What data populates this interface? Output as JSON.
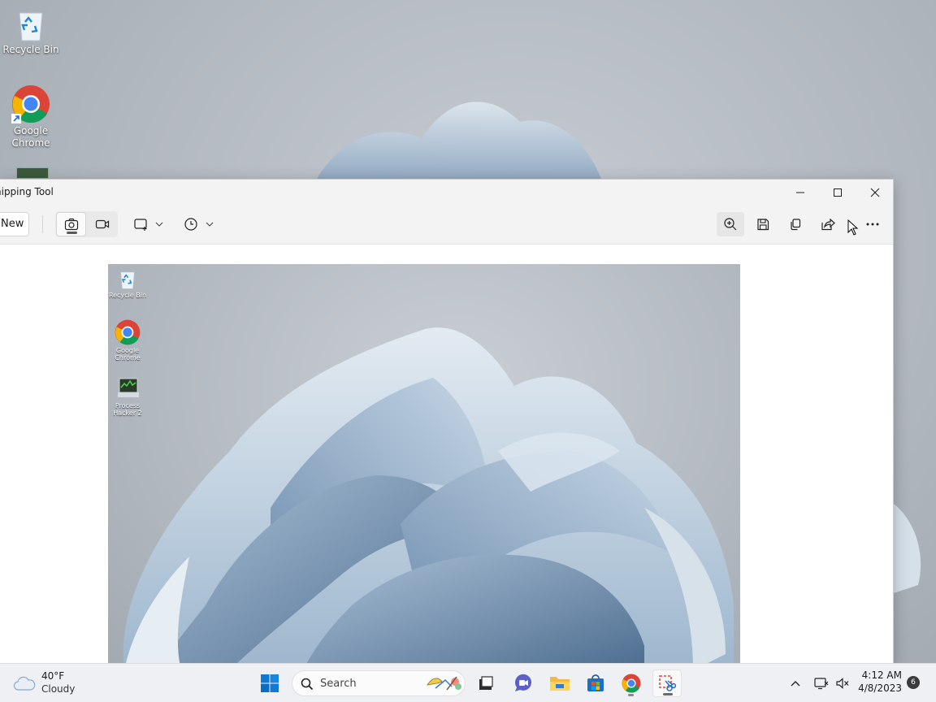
{
  "desktop": {
    "icons": [
      {
        "label": "Recycle Bin"
      },
      {
        "label": "Google Chrome"
      }
    ]
  },
  "window": {
    "title": "nipping Tool",
    "new_label": "New",
    "screenshot": {
      "icons": [
        {
          "label": "Recycle Bin"
        },
        {
          "label": "Google Chrome"
        },
        {
          "label": "Process Hacker 2"
        }
      ]
    }
  },
  "taskbar": {
    "weather": {
      "temp": "40°F",
      "condition": "Cloudy"
    },
    "search_placeholder": "Search",
    "clock": {
      "time": "4:12 AM",
      "date": "4/8/2023"
    },
    "notification_count": "6"
  },
  "colors": {
    "accent": "#0067c0",
    "bloom_light": "#dce6ef",
    "bloom_mid": "#9fb8d0",
    "bloom_dark": "#4f6f91"
  }
}
